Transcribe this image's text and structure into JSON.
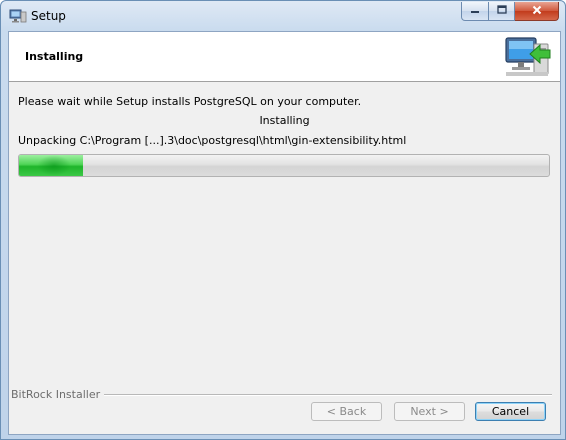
{
  "window": {
    "title": "Setup",
    "app_icon": "setup-computer-icon",
    "caption": {
      "minimize_icon": "minimize-icon",
      "maximize_icon": "maximize-icon",
      "close_icon": "close-icon"
    }
  },
  "header": {
    "title": "Installing",
    "graphic_icon": "computer-install-arrow-icon"
  },
  "body": {
    "message": "Please wait while Setup installs PostgreSQL on your computer.",
    "status": "Installing",
    "current_file": "Unpacking C:\\Program [...].3\\doc\\postgresql\\html\\gin-extensibility.html"
  },
  "progress": {
    "value": 0.12,
    "fill_color": "#2ebd38"
  },
  "footer": {
    "brand": "BitRock Installer",
    "back_label": "< Back",
    "next_label": "Next >",
    "cancel_label": "Cancel"
  }
}
